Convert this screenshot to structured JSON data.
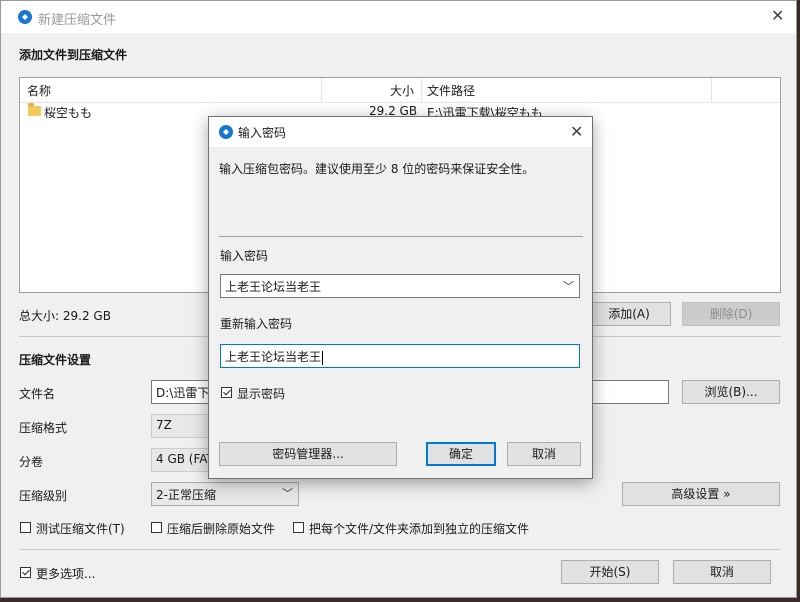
{
  "main": {
    "title": "新建压缩文件",
    "section_add": "添加文件到压缩文件",
    "columns": {
      "name": "名称",
      "size": "大小",
      "path": "文件路径"
    },
    "files": [
      {
        "name": "桜空もも",
        "size": "29.2 GB",
        "path": "E:\\迅雷下载\\桜空もも"
      }
    ],
    "total_label": "总大小: 29.2 GB",
    "add_button": "添加(A)",
    "delete_button": "删除(D)",
    "section_settings": "压缩文件设置",
    "filename_label": "文件名",
    "filename_value": "D:\\迅雷下",
    "browse_button": "浏览(B)...",
    "format_label": "压缩格式",
    "format_value": "7Z",
    "split_label": "分卷",
    "split_value": "4 GB (FAT",
    "level_label": "压缩级别",
    "level_value": "2-正常压缩",
    "advanced_button": "高级设置 »",
    "test_label": "测试压缩文件(T)",
    "delete_after_label": "压缩后删除原始文件",
    "separate_label": "把每个文件/文件夹添加到独立的压缩文件",
    "more_options_label": "更多选项...",
    "start_button": "开始(S)",
    "cancel_button": "取消"
  },
  "dialog": {
    "title": "输入密码",
    "description": "输入压缩包密码。建议使用至少 8 位的密码来保证安全性。",
    "password_label": "输入密码",
    "password_value": "上老王论坛当老王",
    "confirm_label": "重新输入密码",
    "confirm_value": "上老王论坛当老王",
    "show_password_label": "显示密码",
    "manager_button": "密码管理器...",
    "ok_button": "确定",
    "cancel_button": "取消"
  },
  "colors": {
    "accent": "#0078d7",
    "brand": "#1777d1"
  },
  "icons": {
    "app": "app-logo-icon",
    "close": "close-icon",
    "folder": "folder-icon",
    "dropdown": "chevron-down-icon",
    "checkbox": "checkbox-icon"
  }
}
